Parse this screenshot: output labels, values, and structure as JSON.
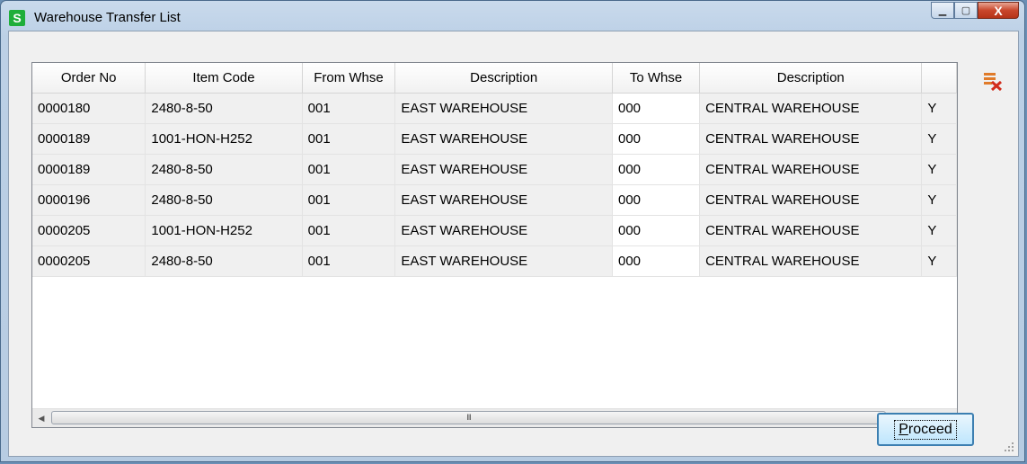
{
  "window": {
    "title": "Warehouse Transfer List",
    "app_icon_letter": "S"
  },
  "titlebar_buttons": {
    "minimize": "▁",
    "maximize": "▢",
    "close": "X"
  },
  "grid": {
    "headers": [
      "Order No",
      "Item Code",
      "From Whse",
      "Description",
      "To Whse",
      "Description",
      ""
    ],
    "rows": [
      [
        "0000180",
        "2480-8-50",
        "001",
        "EAST WAREHOUSE",
        "000",
        "CENTRAL WAREHOUSE",
        "Y"
      ],
      [
        "0000189",
        "1001-HON-H252",
        "001",
        "EAST WAREHOUSE",
        "000",
        "CENTRAL WAREHOUSE",
        "Y"
      ],
      [
        "0000189",
        "2480-8-50",
        "001",
        "EAST WAREHOUSE",
        "000",
        "CENTRAL WAREHOUSE",
        "Y"
      ],
      [
        "0000196",
        "2480-8-50",
        "001",
        "EAST WAREHOUSE",
        "000",
        "CENTRAL WAREHOUSE",
        "Y"
      ],
      [
        "0000205",
        "1001-HON-H252",
        "001",
        "EAST WAREHOUSE",
        "000",
        "CENTRAL WAREHOUSE",
        "Y"
      ],
      [
        "0000205",
        "2480-8-50",
        "001",
        "EAST WAREHOUSE",
        "000",
        "CENTRAL WAREHOUSE",
        "Y"
      ]
    ],
    "scroll_thumb_grip": "III"
  },
  "buttons": {
    "proceed_prefix": "P",
    "proceed_rest": "roceed"
  },
  "icons": {
    "delete": "delete-rows-icon"
  },
  "colors": {
    "app_icon": "#1fae3a",
    "close_button": "#c9472c",
    "delete_icon": "#d22c1c"
  }
}
